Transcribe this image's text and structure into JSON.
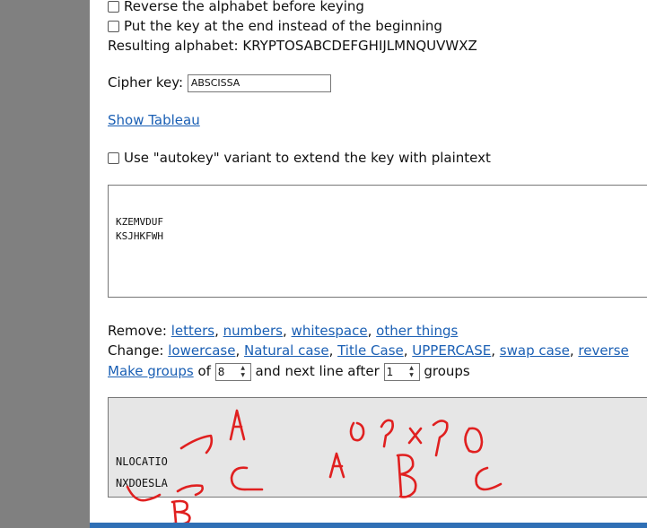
{
  "options": {
    "reverse_label": "Reverse the alphabet before keying",
    "key_end_label": "Put the key at the end instead of the beginning",
    "resulting_alphabet_label": "Resulting alphabet:",
    "resulting_alphabet_value": "KRYPTOSABCDEFGHIJLMNQUVWXZ"
  },
  "cipher_key": {
    "label": "Cipher key:",
    "value": "ABSCISSA"
  },
  "show_tableau": "Show Tableau",
  "autokey_label": "Use \"autokey\" variant to extend the key with plaintext",
  "input_text": {
    "line1": "KZEMVDUF",
    "line2": "KSJHKFWH"
  },
  "remove": {
    "label": "Remove:",
    "letters": "letters",
    "numbers": "numbers",
    "whitespace": "whitespace",
    "other": "other things"
  },
  "change": {
    "label": "Change:",
    "lowercase": "lowercase",
    "natural": "Natural case",
    "title": "Title Case",
    "upper": "UPPERCASE",
    "swap": "swap case",
    "reverse": "reverse"
  },
  "groups": {
    "make_groups": "Make groups",
    "of": "of",
    "group_size": "8",
    "next_line": "and next line after",
    "line_count": "1",
    "groups_word": "groups"
  },
  "output_text": {
    "line1": "NLOCATIO",
    "line2": "NXDOESLA"
  },
  "annotation_color": "#e02020"
}
